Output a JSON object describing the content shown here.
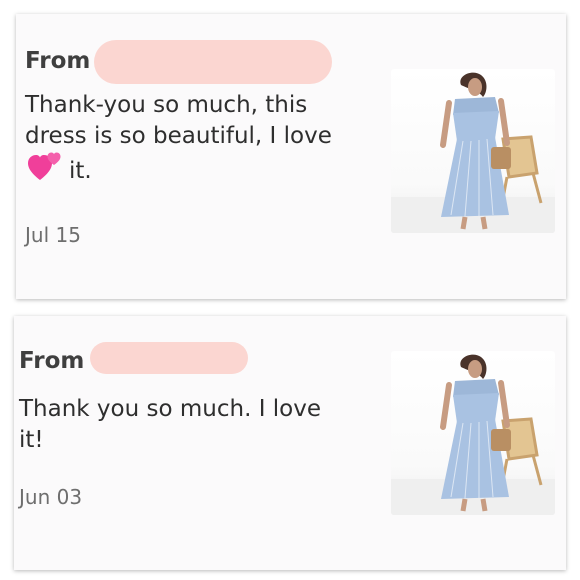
{
  "reviews": [
    {
      "from_label": "From",
      "message_before": "Thank-you so much, this dress is so beautiful, I love",
      "message_emoji": "two-hearts",
      "message_after": "it.",
      "date": "Jul 15"
    },
    {
      "from_label": "From",
      "message_before": "Thank you so much. I love it!",
      "message_emoji": "",
      "message_after": "",
      "date": "Jun 03"
    }
  ],
  "colors": {
    "redaction": "#fbd6d1",
    "heart": "#f03f9a",
    "dress": "#a9c2e2"
  }
}
